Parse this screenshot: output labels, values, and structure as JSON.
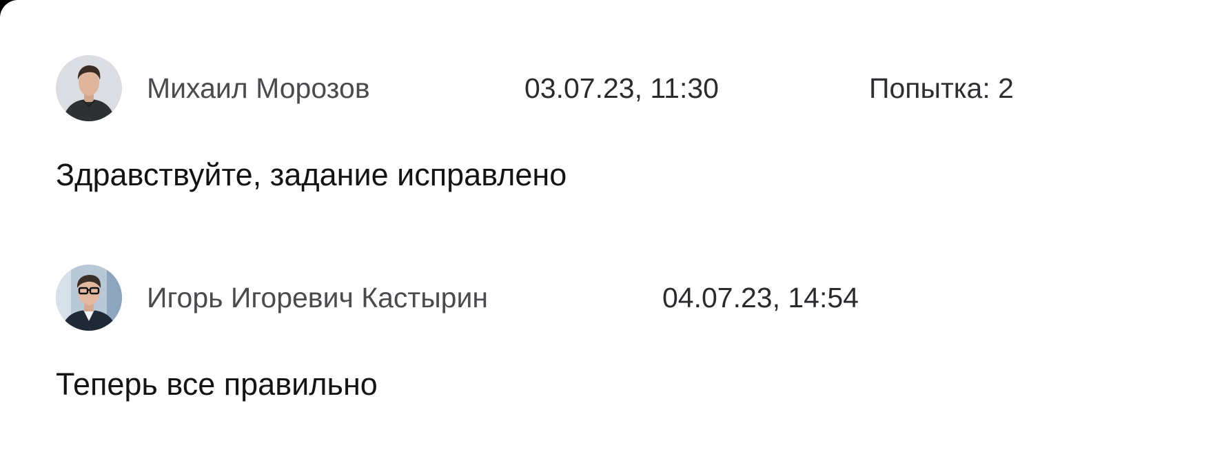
{
  "comments": [
    {
      "author": "Михаил Морозов",
      "date": "03.07.23, 11:30",
      "attempt": "Попытка: 2",
      "message": "Здравствуйте, задание исправлено"
    },
    {
      "author": "Игорь Игоревич Кастырин",
      "date": "04.07.23, 14:54",
      "message": "Теперь все правильно"
    }
  ],
  "colors": {
    "background": "#ffffff",
    "author_text": "#4a4a4f",
    "message_text": "#141416"
  }
}
